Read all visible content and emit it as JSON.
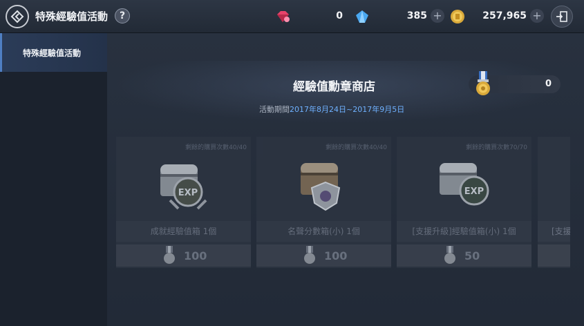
{
  "header": {
    "title": "特殊經驗值活動",
    "help_label": "?",
    "currencies": [
      {
        "name": "ruby",
        "value": "0",
        "color": "#e8436a",
        "icon": "ruby-icon"
      },
      {
        "name": "crystal",
        "value": "385",
        "color": "#4aa8f0",
        "icon": "blue-crystal-icon"
      },
      {
        "name": "gold",
        "value": "257,965",
        "color": "#d9a93a",
        "icon": "gold-coin-icon"
      }
    ],
    "plus_label": "+"
  },
  "sidebar": {
    "items": [
      {
        "label": "特殊經驗值活動",
        "active": true
      }
    ]
  },
  "shop": {
    "title": "經驗值勳章商店",
    "period_label": "活動期間",
    "period_dates": "2017年8月24日~2017年9月5日",
    "medal_count": "0"
  },
  "items": [
    {
      "remain": "剩餘的購買次數40/40",
      "name": "成就經驗值箱 1個",
      "price": "100",
      "icon": "exp-chest-icon"
    },
    {
      "remain": "剩餘的購買次數40/40",
      "name": "名聲分數箱(小) 1個",
      "price": "100",
      "icon": "fame-chest-icon"
    },
    {
      "remain": "剩餘的購買次數70/70",
      "name": "[支援升級]經驗值箱(小) 1個",
      "price": "50",
      "icon": "support-exp-chest-icon"
    },
    {
      "remain": "",
      "name": "[支援",
      "price": "",
      "icon": ""
    }
  ]
}
